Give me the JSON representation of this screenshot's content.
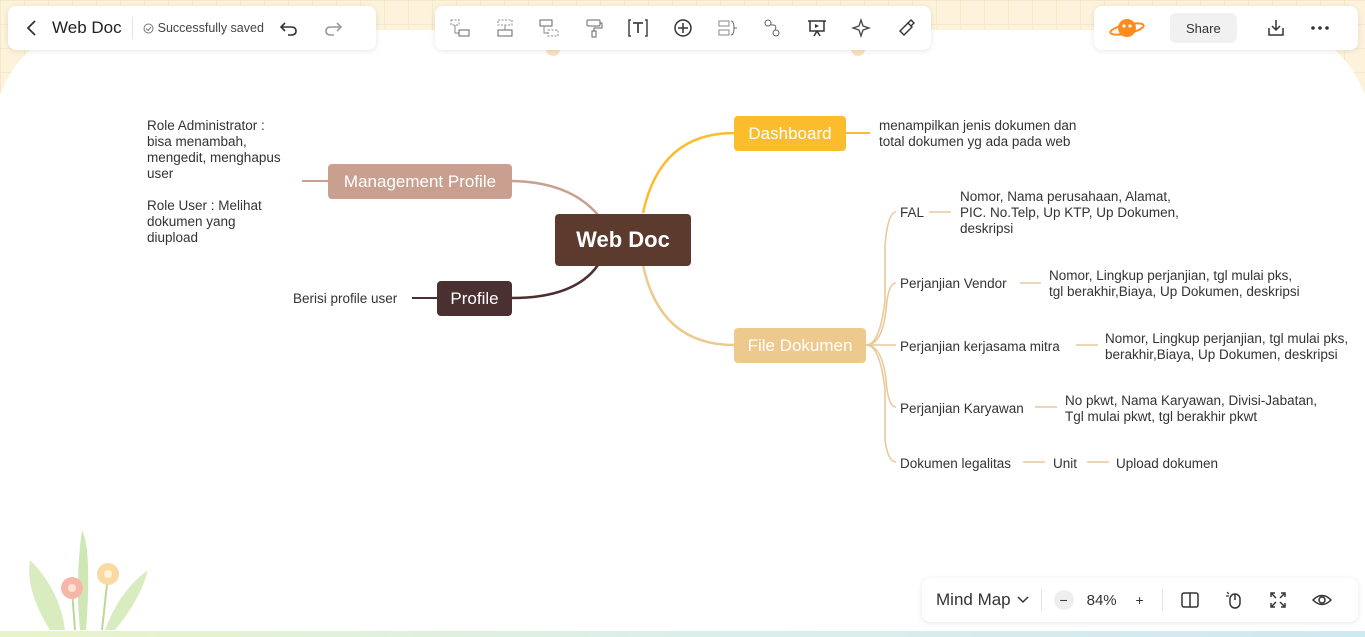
{
  "header": {
    "title": "Web Doc",
    "save_status": "Successfully saved"
  },
  "top_right": {
    "share_label": "Share"
  },
  "toolbar_icons": [
    "add-subtopic-icon",
    "add-sibling-icon",
    "add-parent-icon",
    "format-painter-icon",
    "insert-text-icon",
    "insert-plus-icon",
    "summary-icon",
    "relationship-icon",
    "presentation-icon",
    "ai-sparkle-icon",
    "clear-format-icon"
  ],
  "bottom_bar": {
    "view_mode": "Mind Map",
    "zoom": "84%",
    "minus": "−",
    "plus": "+"
  },
  "mindmap": {
    "root": "Web Doc",
    "management_profile": {
      "label": "Management Profile",
      "notes": [
        "Role Administrator :\nbisa menambah,\nmengedit, menghapus\nuser",
        "Role User : Melihat\ndokumen yang\ndiupload"
      ]
    },
    "profile": {
      "label": "Profile",
      "note": "Berisi profile user"
    },
    "dashboard": {
      "label": "Dashboard",
      "note": "menampilkan jenis dokumen dan\ntotal dokumen yg ada pada web"
    },
    "file_dokumen": {
      "label": "File Dokumen",
      "children": [
        {
          "label": "FAL",
          "detail": "Nomor, Nama perusahaan, Alamat,\nPIC. No.Telp, Up KTP, Up Dokumen,\ndeskripsi"
        },
        {
          "label": "Perjanjian Vendor",
          "detail": "Nomor, Lingkup perjanjian, tgl mulai pks,\ntgl berakhir,Biaya, Up Dokumen, deskripsi"
        },
        {
          "label": "Perjanjian kerjasama mitra",
          "detail": "Nomor, Lingkup perjanjian, tgl mulai pks,\nberakhir,Biaya, Up Dokumen, deskripsi"
        },
        {
          "label": "Perjanjian Karyawan",
          "detail": "No pkwt, Nama Karyawan, Divisi-Jabatan,\nTgl mulai pkwt, tgl berakhir pkwt"
        },
        {
          "label": "Dokumen legalitas",
          "sub": "Unit",
          "detail": "Upload dokumen"
        }
      ]
    }
  },
  "colors": {
    "root": "#5c3a2e",
    "management": "#c9a090",
    "profile": "#4a3030",
    "dashboard": "#fbbd2e",
    "file": "#eec98d",
    "file_line": "#e8c99a"
  }
}
